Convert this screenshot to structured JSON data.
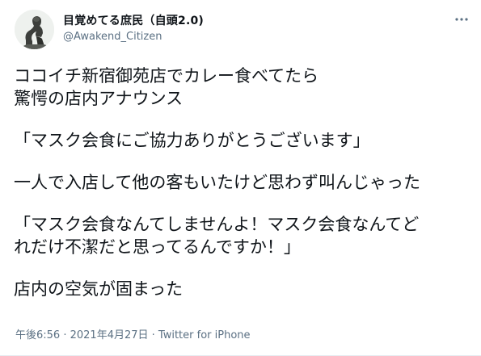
{
  "author": {
    "display_name": "目覚めてる庶民（自頭2.0)",
    "handle": "@Awakend_Citizen",
    "avatar_icon": "thinker-statue-avatar"
  },
  "menu": {
    "icon": "more-horizontal-icon"
  },
  "tweet": {
    "paragraphs": [
      [
        "ココイチ新宿御苑店でカレー食べてたら",
        "驚愕の店内アナウンス"
      ],
      [
        "「マスク会食にご協力ありがとうございます」"
      ],
      [
        "一人で入店して他の客もいたけど思わず叫んじゃった"
      ],
      [
        "「マスク会食なんてしませんよ！マスク会食なんてど",
        "れだけ不潔だと思ってるんですか！」"
      ],
      [
        "店内の空気が固まった"
      ]
    ]
  },
  "meta": {
    "time": "午後6:56",
    "separator": " · ",
    "date": "2021年4月27日",
    "source": "Twitter for iPhone"
  },
  "colors": {
    "text": "#0f1419",
    "secondary": "#5b7083",
    "background": "#ffffff"
  }
}
